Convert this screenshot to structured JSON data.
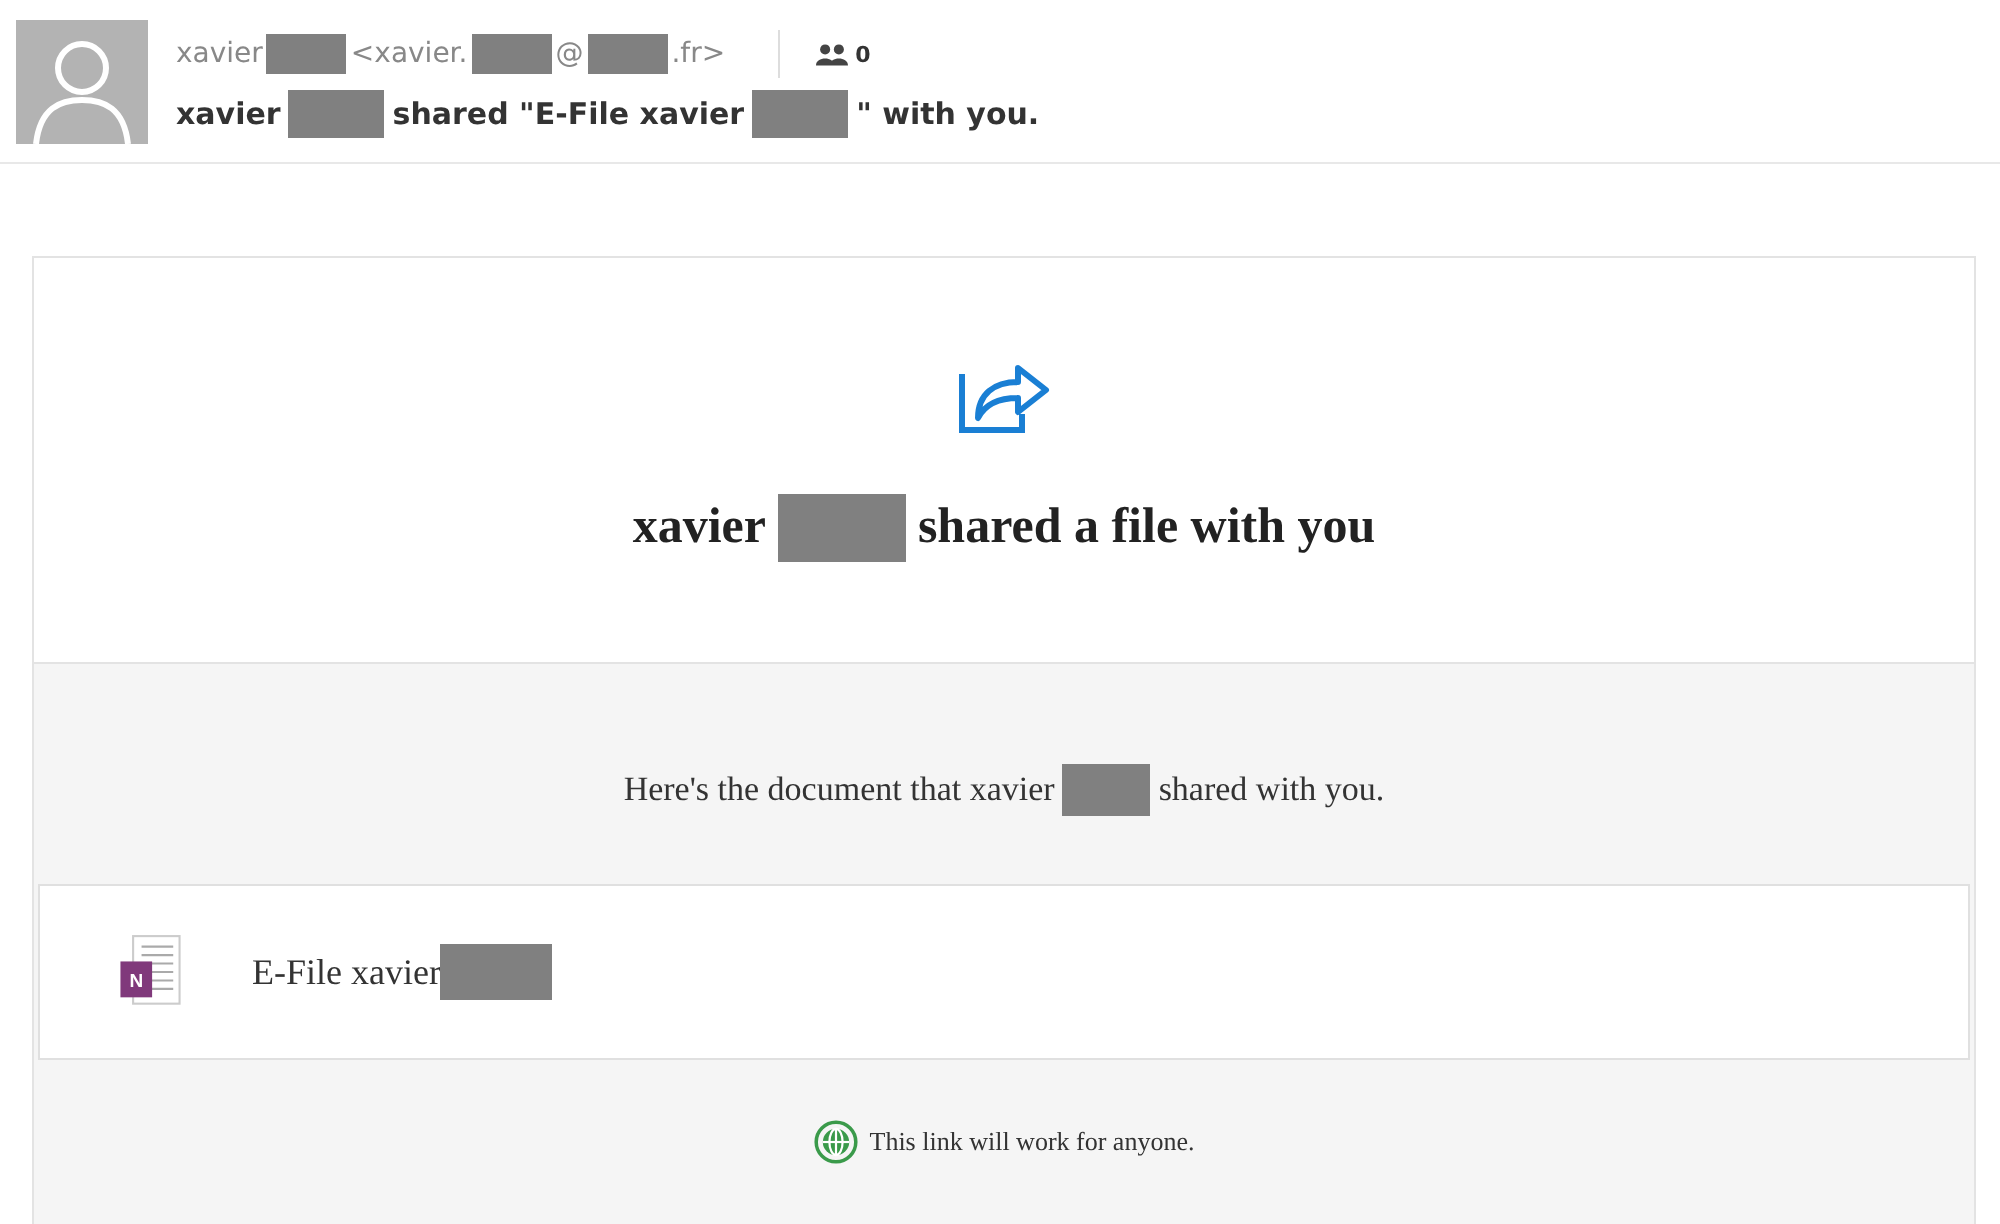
{
  "header": {
    "sender": [
      {
        "kind": "text",
        "text": "xavier"
      },
      {
        "kind": "redacted"
      },
      {
        "kind": "text",
        "text": "<xavier."
      },
      {
        "kind": "redacted"
      },
      {
        "kind": "text",
        "text": "@"
      },
      {
        "kind": "redacted"
      },
      {
        "kind": "text",
        "text": ".fr>"
      }
    ],
    "people_count": "0",
    "subject": [
      {
        "kind": "text",
        "text": "xavier"
      },
      {
        "kind": "redacted"
      },
      {
        "kind": "text",
        "text": "shared \"E-File xavier"
      },
      {
        "kind": "redacted"
      },
      {
        "kind": "text",
        "text": "\" with you."
      }
    ]
  },
  "card": {
    "heading": [
      {
        "kind": "text",
        "text": "xavier"
      },
      {
        "kind": "redacted"
      },
      {
        "kind": "text",
        "text": "shared a file with you"
      }
    ],
    "message": [
      {
        "kind": "text",
        "text": "Here's the document that xavier"
      },
      {
        "kind": "redacted"
      },
      {
        "kind": "text",
        "text": "shared with you."
      }
    ],
    "file": {
      "icon_letter": "N",
      "name": [
        {
          "kind": "text",
          "text": "E-File xavier"
        },
        {
          "kind": "redacted"
        }
      ]
    },
    "note": "This link will work for anyone."
  }
}
